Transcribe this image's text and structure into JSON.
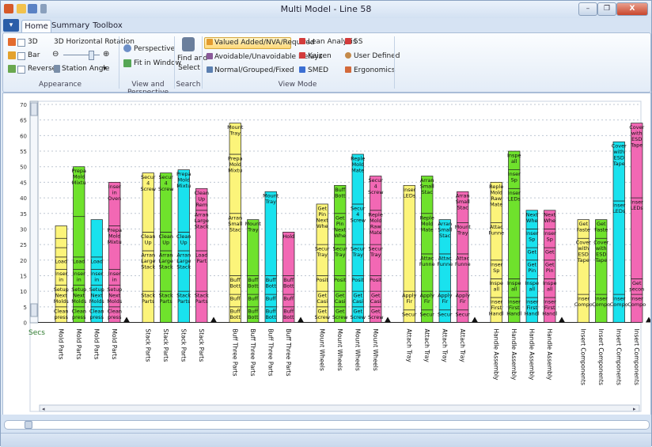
{
  "window": {
    "title": "Multi Model - Line 58",
    "minimize": "–",
    "restore": "❐",
    "close": "X"
  },
  "tabs": [
    {
      "label": "Home",
      "active": true
    },
    {
      "label": "Summary",
      "active": false
    },
    {
      "label": "Toolbox",
      "active": false
    }
  ],
  "ribbon": {
    "appearance": {
      "title": "Appearance",
      "opt_3d": "3D",
      "opt_bar": "Bar",
      "opt_reverse": "Reverse",
      "rotation_label": "3D Horizontal Rotation",
      "station_angle": "Station Angle"
    },
    "view": {
      "title": "View and Perspective",
      "perspective": "Perspective",
      "fit": "Fit in Window"
    },
    "search": {
      "title": "Search",
      "find": "Find and",
      "select": "Select"
    },
    "viewmode": {
      "title": "View Mode",
      "valued": "Valued Added/NVA/Required",
      "avoidable": "Avoidable/Unavoidable Delays",
      "normal": "Normal/Grouped/Fixed",
      "lean": "Lean Analysis",
      "kaizen": "Kaizen",
      "smed": "SMED",
      "fives": "5S",
      "user": "User Defined",
      "ergo": "Ergonomics"
    }
  },
  "chart_data": {
    "type": "bar",
    "stacked": true,
    "ylabel": "Secs",
    "ylim": [
      0,
      70
    ],
    "yticks": [
      0,
      5,
      10,
      15,
      20,
      25,
      30,
      35,
      40,
      45,
      50,
      55,
      60,
      65,
      70
    ],
    "grid": true,
    "colors": {
      "yellow": "#fcf47a",
      "green": "#6fe22c",
      "cyan": "#19e2ee",
      "pink": "#f268b4"
    },
    "groups": [
      {
        "bars": [
          {
            "label": "Mold Parts",
            "color": "yellow",
            "total": 33,
            "segments": [
              {
                "value": 5,
                "text": "Clean press Cavity"
              },
              {
                "value": 7,
                "text": "Setup Next Molds"
              },
              {
                "value": 5,
                "text": "Insert in Oven"
              },
              {
                "value": 4,
                "text": "Load Parts"
              },
              {
                "value": 3,
                "text": ""
              },
              {
                "value": 3,
                "text": ""
              },
              {
                "value": 4,
                "text": ""
              }
            ]
          },
          {
            "label": "Mold Parts",
            "color": "green",
            "total": 50,
            "segments": [
              {
                "value": 5,
                "text": "Clean press Cavity"
              },
              {
                "value": 7,
                "text": "Setup Next Molds"
              },
              {
                "value": 5,
                "text": "Insert in Oven"
              },
              {
                "value": 4,
                "text": "Load Parts"
              },
              {
                "value": 13,
                "text": ""
              },
              {
                "value": 16,
                "text": "Prepare Mold Mixture"
              }
            ]
          },
          {
            "label": "Mold Parts",
            "color": "cyan",
            "total": 33,
            "segments": [
              {
                "value": 5,
                "text": "Clean press Cavity"
              },
              {
                "value": 7,
                "text": "Setup Next Molds"
              },
              {
                "value": 5,
                "text": "Insert in Oven"
              },
              {
                "value": 4,
                "text": "Load Parts"
              },
              {
                "value": 12,
                "text": ""
              }
            ]
          },
          {
            "label": "Mold Parts",
            "color": "pink",
            "total": 45,
            "segments": [
              {
                "value": 5,
                "text": "Clean press Cavity"
              },
              {
                "value": 7,
                "text": "Setup Next Molds"
              },
              {
                "value": 5,
                "text": "Insert in Oven"
              },
              {
                "value": 14,
                "text": "Prepare Mold Mixture"
              },
              {
                "value": 14,
                "text": "Insert in Oven"
              }
            ]
          }
        ]
      },
      {
        "bars": [
          {
            "label": "Stack Parts",
            "color": "yellow",
            "total": 48,
            "segments": [
              {
                "value": 10,
                "text": "Stack Parts"
              },
              {
                "value": 13,
                "text": "Arrange Large Stack"
              },
              {
                "value": 6,
                "text": "Clean Up Rem"
              },
              {
                "value": 19,
                "text": "Secure 4 Screws"
              }
            ]
          },
          {
            "label": "Stack Parts",
            "color": "green",
            "total": 48,
            "segments": [
              {
                "value": 10,
                "text": "Stack Parts"
              },
              {
                "value": 13,
                "text": "Arrange Large Stack"
              },
              {
                "value": 6,
                "text": "Clean Up Rem"
              },
              {
                "value": 19,
                "text": "Secure 4 Screws"
              }
            ]
          },
          {
            "label": "Stack Parts",
            "color": "cyan",
            "total": 49,
            "segments": [
              {
                "value": 10,
                "text": "Stack Parts"
              },
              {
                "value": 13,
                "text": "Arrange Large Stack"
              },
              {
                "value": 6,
                "text": "Clean Up Rem"
              },
              {
                "value": 20,
                "text": "Prepare Mold Mixture"
              }
            ]
          },
          {
            "label": "Stack Parts",
            "color": "pink",
            "total": 43,
            "segments": [
              {
                "value": 10,
                "text": "Stack Parts"
              },
              {
                "value": 13,
                "text": "Load Part"
              },
              {
                "value": 13,
                "text": "Arrange Large Stack"
              },
              {
                "value": 7,
                "text": "Clean Up Rem"
              }
            ]
          }
        ]
      },
      {
        "bars": [
          {
            "label": "Buff Three Parts",
            "color": "yellow",
            "total": 64,
            "segments": [
              {
                "value": 5,
                "text": "Buff Bott"
              },
              {
                "value": 4,
                "text": "Buff Side"
              },
              {
                "value": 6,
                "text": "Buff Bott"
              },
              {
                "value": 20,
                "text": "Arrange Small Stac"
              },
              {
                "value": 19,
                "text": "Prepare Mold Mixture"
              },
              {
                "value": 10,
                "text": "Mount Tray"
              }
            ]
          },
          {
            "label": "Buff Three Parts",
            "color": "green",
            "total": 33,
            "segments": [
              {
                "value": 5,
                "text": "Buff Bott"
              },
              {
                "value": 4,
                "text": "Buff Side"
              },
              {
                "value": 6,
                "text": "Buff Bott"
              },
              {
                "value": 18,
                "text": "Mount Tray"
              }
            ]
          },
          {
            "label": "Buff Three Parts",
            "color": "cyan",
            "total": 42,
            "segments": [
              {
                "value": 5,
                "text": "Buff Bott"
              },
              {
                "value": 4,
                "text": "Buff Side"
              },
              {
                "value": 6,
                "text": "Buff Bott"
              },
              {
                "value": 27,
                "text": "Mount Tray"
              }
            ]
          },
          {
            "label": "Buff Three Parts",
            "color": "pink",
            "total": 29,
            "segments": [
              {
                "value": 5,
                "text": "Buff Bott"
              },
              {
                "value": 4,
                "text": "Buff Side"
              },
              {
                "value": 6,
                "text": "Buff Bott"
              },
              {
                "value": 14,
                "text": "Hold"
              }
            ]
          }
        ]
      },
      {
        "bars": [
          {
            "label": "Mount Wheels",
            "color": "yellow",
            "total": 38,
            "segments": [
              {
                "value": 5,
                "text": "Get Screw"
              },
              {
                "value": 5,
                "text": "Get Casi"
              },
              {
                "value": 5,
                "text": "Position"
              },
              {
                "value": 10,
                "text": "Secure Tray"
              },
              {
                "value": 13,
                "text": "Get Pin Next Whe"
              }
            ]
          },
          {
            "label": "Mount Wheels",
            "color": "green",
            "total": 44,
            "segments": [
              {
                "value": 5,
                "text": "Get Screw"
              },
              {
                "value": 5,
                "text": "Get Casi"
              },
              {
                "value": 5,
                "text": "Position"
              },
              {
                "value": 10,
                "text": "Secure Tray"
              },
              {
                "value": 10,
                "text": "Get Pin Next Whe"
              },
              {
                "value": 9,
                "text": "Buff Bott"
              }
            ]
          },
          {
            "label": "Mount Wheels",
            "color": "cyan",
            "total": 54,
            "segments": [
              {
                "value": 5,
                "text": "Get Screw"
              },
              {
                "value": 5,
                "text": "Get Casi"
              },
              {
                "value": 5,
                "text": "Position"
              },
              {
                "value": 10,
                "text": "Secure Tray"
              },
              {
                "value": 13,
                "text": "Secure 4 Screws"
              },
              {
                "value": 16,
                "text": "Replenish Mold Mate"
              }
            ]
          },
          {
            "label": "Mount Wheels",
            "color": "pink",
            "total": 47,
            "segments": [
              {
                "value": 5,
                "text": "Get Screw"
              },
              {
                "value": 5,
                "text": "Get Casi"
              },
              {
                "value": 5,
                "text": "Position"
              },
              {
                "value": 10,
                "text": "Secure Tray"
              },
              {
                "value": 11,
                "text": "Replenish Mold Raw Mate"
              },
              {
                "value": 11,
                "text": "Secure 4 Screws"
              }
            ]
          }
        ]
      },
      {
        "bars": [
          {
            "label": "Attach Tray",
            "color": "yellow",
            "total": 44,
            "segments": [
              {
                "value": 4,
                "text": "Secure"
              },
              {
                "value": 6,
                "text": "Apply Fir"
              },
              {
                "value": 34,
                "text": "Insert LEDs"
              }
            ]
          },
          {
            "label": "Attach Tray",
            "color": "green",
            "total": 47,
            "segments": [
              {
                "value": 4,
                "text": "Secure"
              },
              {
                "value": 6,
                "text": "Apply Fir"
              },
              {
                "value": 12,
                "text": "Attach Funnel"
              },
              {
                "value": 13,
                "text": "Replenish Mold Mate"
              },
              {
                "value": 12,
                "text": "Arrange Small Stac"
              }
            ]
          },
          {
            "label": "Attach Tray",
            "color": "cyan",
            "total": 33,
            "segments": [
              {
                "value": 4,
                "text": "Secure"
              },
              {
                "value": 6,
                "text": "Apply Fir"
              },
              {
                "value": 12,
                "text": "Attach Funnel"
              },
              {
                "value": 11,
                "text": "Arrange Small Stac"
              }
            ]
          },
          {
            "label": "Attach Tray",
            "color": "pink",
            "total": 42,
            "segments": [
              {
                "value": 4,
                "text": "Secure"
              },
              {
                "value": 6,
                "text": "Apply Fir"
              },
              {
                "value": 12,
                "text": "Attach Funnel"
              },
              {
                "value": 10,
                "text": "Mount Tray"
              },
              {
                "value": 10,
                "text": "Arrange Small Stac"
              }
            ]
          }
        ]
      },
      {
        "bars": [
          {
            "label": "Handle Assembly",
            "color": "yellow",
            "total": 45,
            "segments": [
              {
                "value": 8,
                "text": "Insert First Handle"
              },
              {
                "value": 6,
                "text": "Inspect all"
              },
              {
                "value": 6,
                "text": "Insert Sp"
              },
              {
                "value": 12,
                "text": "Attach Funnel"
              },
              {
                "value": 13,
                "text": "Replenish Mold Raw Mate"
              }
            ]
          },
          {
            "label": "Handle Assembly",
            "color": "green",
            "total": 55,
            "segments": [
              {
                "value": 8,
                "text": "Insert First Handle"
              },
              {
                "value": 6,
                "text": "Inspect all"
              },
              {
                "value": 29,
                "text": "Insert LEDs"
              },
              {
                "value": 6,
                "text": "Insert Sp"
              },
              {
                "value": 6,
                "text": "Inspect all"
              }
            ]
          },
          {
            "label": "Handle Assembly",
            "color": "cyan",
            "total": 36,
            "segments": [
              {
                "value": 8,
                "text": "Insert First Handle"
              },
              {
                "value": 6,
                "text": "Inspect all"
              },
              {
                "value": 6,
                "text": "Get Pin"
              },
              {
                "value": 4,
                "text": "Get Fast"
              },
              {
                "value": 6,
                "text": "Insert Sp"
              },
              {
                "value": 6,
                "text": "Next Whe"
              }
            ]
          },
          {
            "label": "Handle Assembly",
            "color": "pink",
            "total": 36,
            "segments": [
              {
                "value": 8,
                "text": "Insert First Handle"
              },
              {
                "value": 6,
                "text": "Inspect all"
              },
              {
                "value": 6,
                "text": "Get Pin"
              },
              {
                "value": 4,
                "text": "Get Fast"
              },
              {
                "value": 6,
                "text": "Insert Sp"
              },
              {
                "value": 6,
                "text": "Next Whe"
              }
            ]
          }
        ]
      },
      {
        "bars": [
          {
            "label": "Insert Components",
            "color": "yellow",
            "total": 33,
            "segments": [
              {
                "value": 9,
                "text": "Insert Component"
              },
              {
                "value": 18,
                "text": "Cover with ESD Tape"
              },
              {
                "value": 6,
                "text": "Get Fastener"
              }
            ]
          },
          {
            "label": "Insert Components",
            "color": "green",
            "total": 33,
            "segments": [
              {
                "value": 9,
                "text": "Insert Component"
              },
              {
                "value": 18,
                "text": "Cover with ESD Tape"
              },
              {
                "value": 6,
                "text": "Get Fastener"
              }
            ]
          },
          {
            "label": "Insert Components",
            "color": "cyan",
            "total": 58,
            "segments": [
              {
                "value": 9,
                "text": "Insert Component"
              },
              {
                "value": 30,
                "text": "Insert LEDs"
              },
              {
                "value": 19,
                "text": "Cover with ESD Tape"
              }
            ]
          },
          {
            "label": "Insert Components",
            "color": "pink",
            "total": 64,
            "segments": [
              {
                "value": 9,
                "text": "Insert Component"
              },
              {
                "value": 5,
                "text": "Get second fa"
              },
              {
                "value": 26,
                "text": "Insert LEDs"
              },
              {
                "value": 24,
                "text": "Cover with ESD Tape"
              }
            ]
          }
        ]
      }
    ]
  }
}
